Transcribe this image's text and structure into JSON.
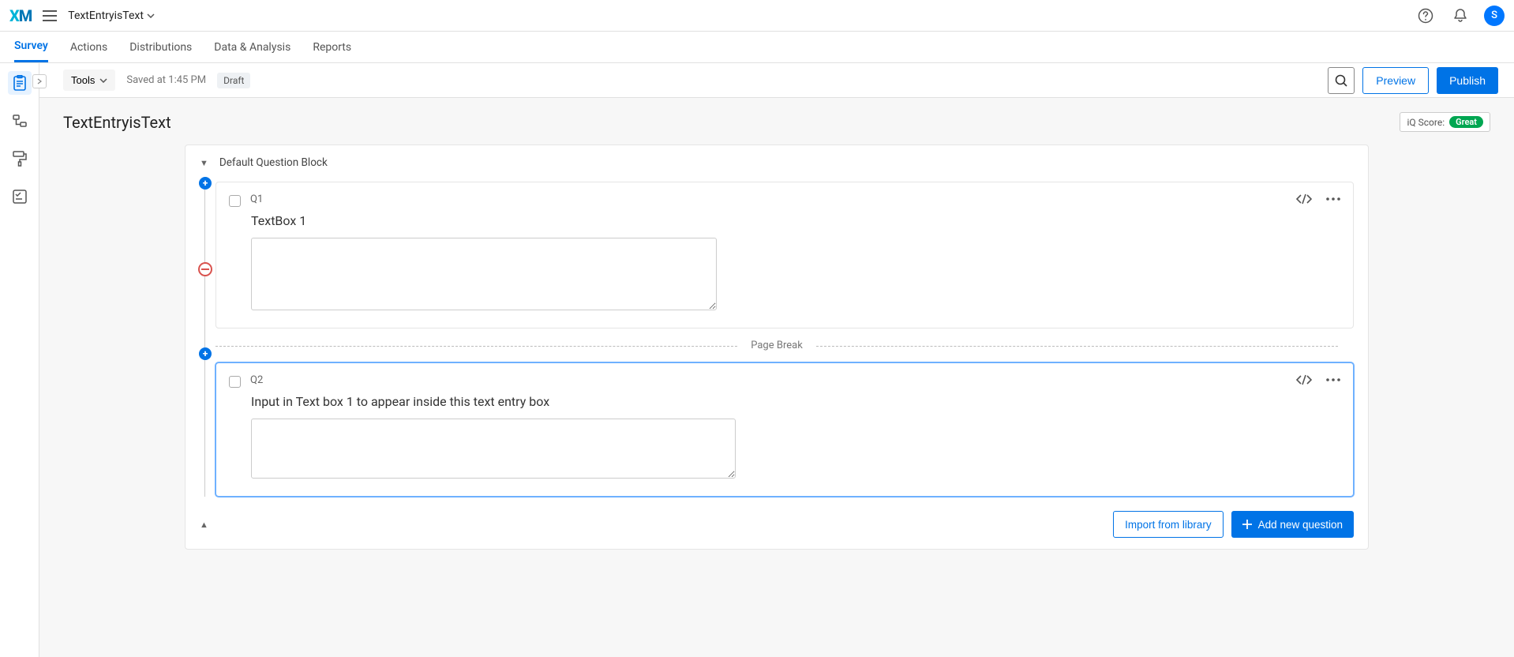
{
  "header": {
    "project_name": "TextEntryisText",
    "avatar_initial": "S"
  },
  "tabs": {
    "survey": "Survey",
    "actions": "Actions",
    "distributions": "Distributions",
    "data_analysis": "Data & Analysis",
    "reports": "Reports"
  },
  "toolbar": {
    "tools": "Tools",
    "saved": "Saved at 1:45 PM",
    "draft": "Draft",
    "preview": "Preview",
    "publish": "Publish"
  },
  "canvas": {
    "title": "TextEntryisText",
    "iq_label": "iQ Score:",
    "iq_value": "Great"
  },
  "block": {
    "name": "Default Question Block",
    "page_break": "Page Break",
    "import": "Import from library",
    "add_question": "Add new question"
  },
  "questions": {
    "q1": {
      "num": "Q1",
      "text": "TextBox 1"
    },
    "q2": {
      "num": "Q2",
      "text": "Input in Text box 1 to appear inside this text entry box"
    }
  }
}
